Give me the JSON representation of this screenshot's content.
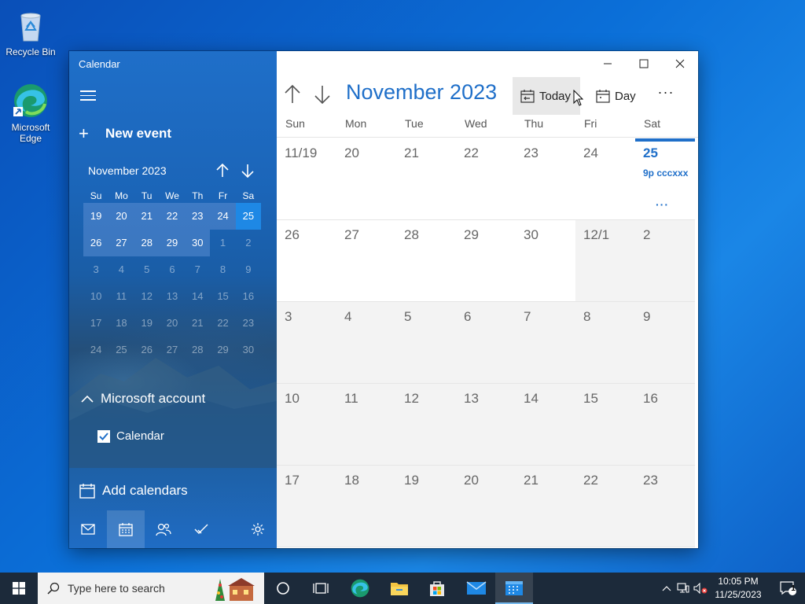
{
  "desktop": {
    "recycle_bin_label": "Recycle Bin",
    "edge_label": "Microsoft Edge"
  },
  "window": {
    "app_title": "Calendar",
    "new_event_label": "New event",
    "mini_calendar": {
      "title": "November 2023",
      "weekdays": [
        "Su",
        "Mo",
        "Tu",
        "We",
        "Th",
        "Fr",
        "Sa"
      ],
      "weeks": [
        [
          "19",
          "20",
          "21",
          "22",
          "23",
          "24",
          "25"
        ],
        [
          "26",
          "27",
          "28",
          "29",
          "30",
          "1",
          "2"
        ],
        [
          "3",
          "4",
          "5",
          "6",
          "7",
          "8",
          "9"
        ],
        [
          "10",
          "11",
          "12",
          "13",
          "14",
          "15",
          "16"
        ],
        [
          "17",
          "18",
          "19",
          "20",
          "21",
          "22",
          "23"
        ],
        [
          "24",
          "25",
          "26",
          "27",
          "28",
          "29",
          "30"
        ]
      ]
    },
    "account_label": "Microsoft account",
    "calendar_checkbox_label": "Calendar",
    "add_calendars_label": "Add calendars",
    "toolbar": {
      "month_title": "November 2023",
      "today_label": "Today",
      "day_label": "Day",
      "more_label": "···"
    },
    "weekday_headers": [
      "Sun",
      "Mon",
      "Tue",
      "Wed",
      "Thu",
      "Fri",
      "Sat"
    ],
    "month_grid": [
      [
        "11/19",
        "20",
        "21",
        "22",
        "23",
        "24",
        "25"
      ],
      [
        "26",
        "27",
        "28",
        "29",
        "30",
        "12/1",
        "2"
      ],
      [
        "3",
        "4",
        "5",
        "6",
        "7",
        "8",
        "9"
      ],
      [
        "10",
        "11",
        "12",
        "13",
        "14",
        "15",
        "16"
      ],
      [
        "17",
        "18",
        "19",
        "20",
        "21",
        "22",
        "23"
      ]
    ],
    "today_event": "9p cccxxx",
    "today_more": "···"
  },
  "taskbar": {
    "search_placeholder": "Type here to search",
    "time": "10:05 PM",
    "date": "11/25/2023",
    "notification_count": "1"
  },
  "colors": {
    "accent": "#1f6fc9",
    "today_highlight": "#1e88e5"
  }
}
